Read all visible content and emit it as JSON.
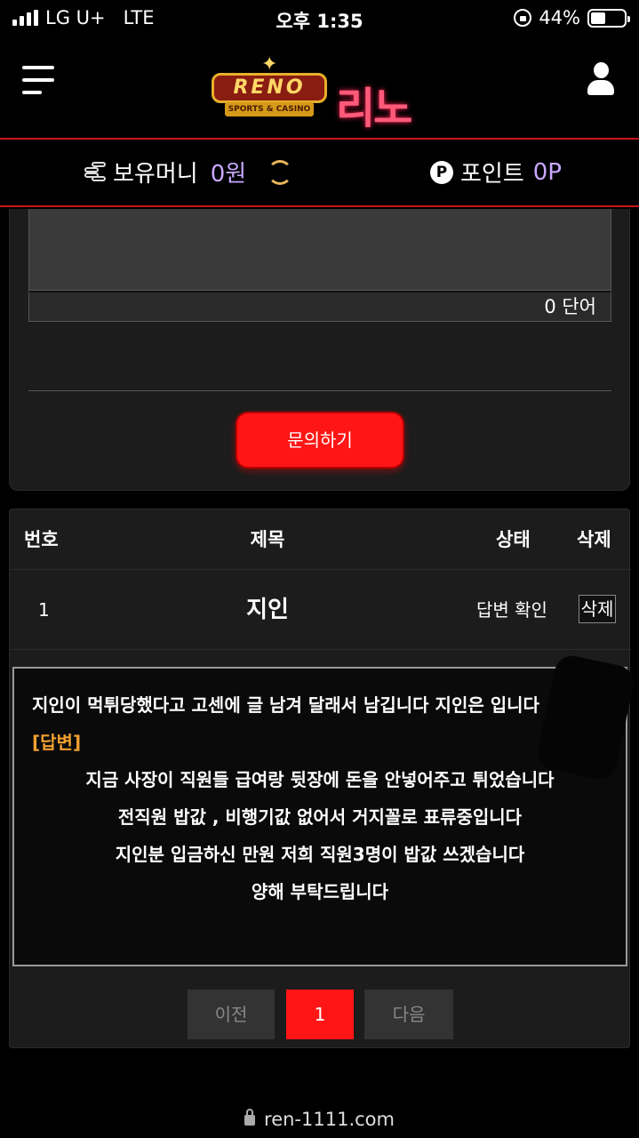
{
  "status_bar": {
    "carrier": "LG U+",
    "network": "LTE",
    "time": "오후 1:35",
    "battery": "44%",
    "battery_level": 0.44
  },
  "header": {
    "logo_text": "RENO",
    "logo_sub": "SPORTS & CASINO",
    "logo_korean": "리노",
    "menu_icon": "hamburger-icon",
    "user_icon": "user-icon"
  },
  "wallet": {
    "money_label": "보유머니",
    "money_value": "0원",
    "point_label": "포인트",
    "point_value": "0P",
    "point_badge": "P"
  },
  "form": {
    "word_count": "0 단어",
    "submit_label": "문의하기"
  },
  "table": {
    "headers": [
      "번호",
      "제목",
      "상태",
      "삭제"
    ],
    "rows": [
      {
        "number": "1",
        "title": "지인",
        "status": "답변 확인",
        "delete_label": "삭제"
      }
    ]
  },
  "detail": {
    "question": "지인이 먹튀당했다고 고센에 글 남겨 달래서 남깁니다 지인은 입니다",
    "answer_label": "[답변]",
    "answer_lines": [
      "지금 사장이 직원들 급여랑 뒷장에 돈을 안넣어주고 튀었습니다",
      "전직원 밥값 , 비행기값 없어서 거지꼴로 표류중입니다",
      "지인분 입금하신 만원 저희 직원3명이 밥값 쓰겠습니다",
      "양해 부탁드립니다"
    ]
  },
  "pagination": {
    "prev": "이전",
    "current": "1",
    "next": "다음"
  },
  "url_bar": {
    "url": "ren-1111.com"
  },
  "colors": {
    "accent_red": "#ff1515",
    "value_purple": "#c8a8ff",
    "answer_orange": "#f0a030"
  }
}
